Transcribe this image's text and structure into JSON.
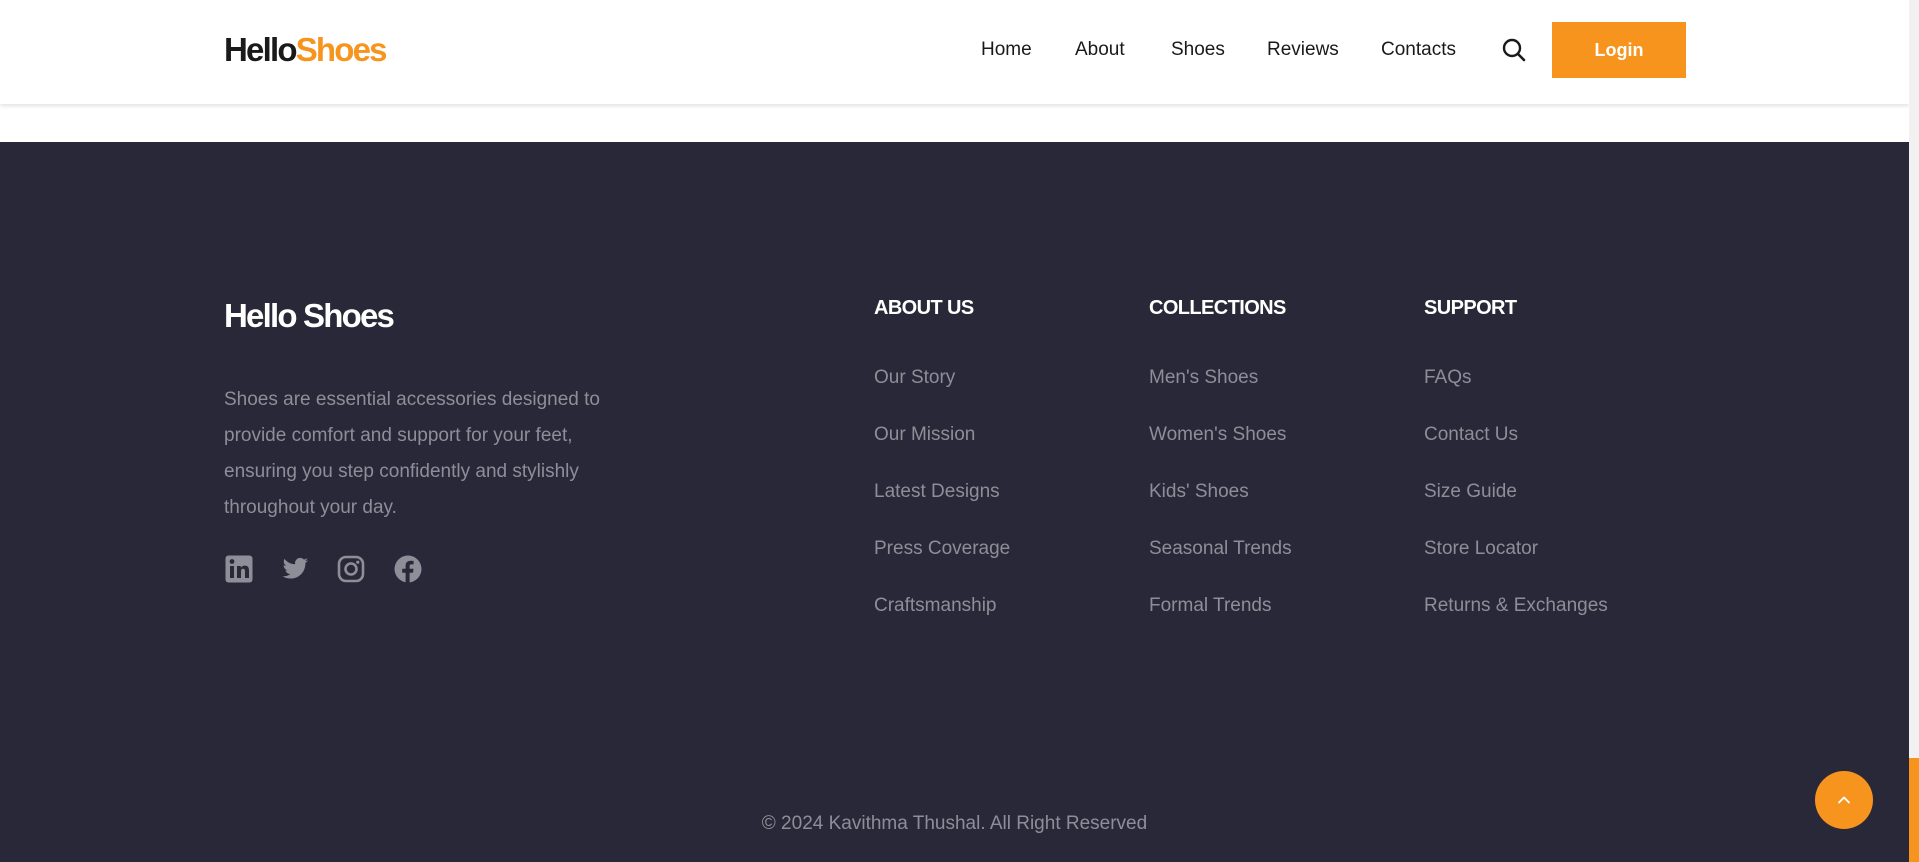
{
  "header": {
    "logo_part1": "Hello",
    "logo_part2": "Shoes",
    "nav": [
      "Home",
      "About",
      "Shoes",
      "Reviews",
      "Contacts"
    ],
    "search_icon": "search-icon",
    "login_label": "Login"
  },
  "footer": {
    "logo": "Hello Shoes",
    "description": "Shoes are essential accessories designed to provide comfort and support for your feet, ensuring you step confidently and stylishly throughout your day.",
    "social_icons": [
      "linkedin-icon",
      "twitter-icon",
      "instagram-icon",
      "facebook-icon"
    ],
    "columns": [
      {
        "title": "ABOUT US",
        "links": [
          "Our Story",
          "Our Mission",
          "Latest Designs",
          "Press Coverage",
          "Craftsmanship"
        ]
      },
      {
        "title": "COLLECTIONS",
        "links": [
          "Men's Shoes",
          "Women's Shoes",
          "Kids' Shoes",
          "Seasonal Trends",
          "Formal Trends"
        ]
      },
      {
        "title": "SUPPORT",
        "links": [
          "FAQs",
          "Contact Us",
          "Size Guide",
          "Store Locator",
          "Returns & Exchanges"
        ]
      }
    ],
    "copyright": "© 2024 Kavithma Thushal. All Right Reserved",
    "back_to_top_icon": "chevron-up-icon"
  },
  "colors": {
    "accent": "#f7941d",
    "footer_bg": "#292838",
    "muted_text": "#8e8e98"
  }
}
